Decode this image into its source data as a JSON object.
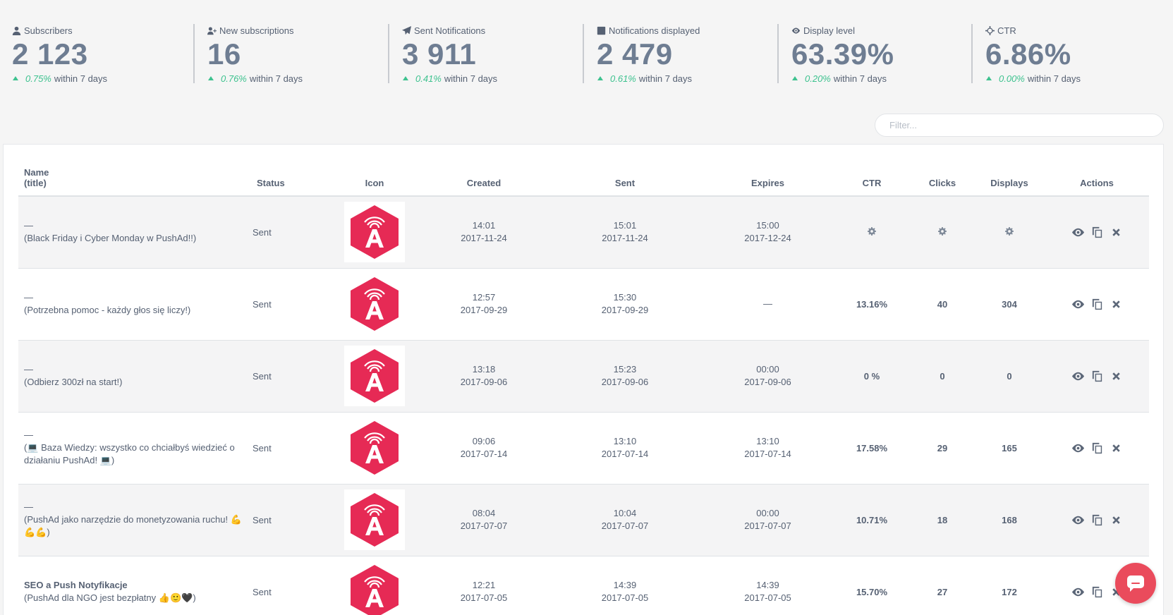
{
  "stats": [
    {
      "label": "Subscribers",
      "icon": "user-icon",
      "value": "2 123",
      "pct": "0.75%",
      "suffix": "within 7 days"
    },
    {
      "label": "New subscriptions",
      "icon": "user-plus-icon",
      "value": "16",
      "pct": "0.76%",
      "suffix": "within 7 days"
    },
    {
      "label": "Sent Notifications",
      "icon": "paper-plane-icon",
      "value": "3 911",
      "pct": "0.41%",
      "suffix": "within 7 days"
    },
    {
      "label": "Notifications displayed",
      "icon": "check-square-icon",
      "value": "2 479",
      "pct": "0.61%",
      "suffix": "within 7 days"
    },
    {
      "label": "Display level",
      "icon": "eye-icon",
      "value": "63.39%",
      "pct": "0.20%",
      "suffix": "within 7 days"
    },
    {
      "label": "CTR",
      "icon": "crosshair-icon",
      "value": "6.86%",
      "pct": "0.00%",
      "suffix": "within 7 days"
    }
  ],
  "filter": {
    "placeholder": "Filter..."
  },
  "table": {
    "headers": {
      "name": "Name",
      "title": "(title)",
      "status": "Status",
      "icon": "Icon",
      "created": "Created",
      "sent": "Sent",
      "expires": "Expires",
      "ctr": "CTR",
      "clicks": "Clicks",
      "displays": "Displays",
      "actions": "Actions"
    },
    "rows": [
      {
        "name": "—",
        "title": "(Black Friday i Cyber Monday w PushAd!!)",
        "status": "Sent",
        "created_time": "14:01",
        "created_date": "2017-11-24",
        "sent_time": "15:01",
        "sent_date": "2017-11-24",
        "expires_time": "15:00",
        "expires_date": "2017-12-24",
        "ctr": "",
        "clicks": "",
        "displays": "",
        "pending": true
      },
      {
        "name": "—",
        "title": "(Potrzebna pomoc - każdy głos się liczy!)",
        "status": "Sent",
        "created_time": "12:57",
        "created_date": "2017-09-29",
        "sent_time": "15:30",
        "sent_date": "2017-09-29",
        "expires_time": "—",
        "expires_date": "",
        "ctr": "13.16%",
        "clicks": "40",
        "displays": "304"
      },
      {
        "name": "—",
        "title": "(Odbierz 300zł na start!)",
        "status": "Sent",
        "created_time": "13:18",
        "created_date": "2017-09-06",
        "sent_time": "15:23",
        "sent_date": "2017-09-06",
        "expires_time": "00:00",
        "expires_date": "2017-09-06",
        "ctr": "0 %",
        "clicks": "0",
        "displays": "0"
      },
      {
        "name": "—",
        "title": "(💻 Baza Wiedzy: wszystko co chciałbyś wiedzieć o działaniu PushAd! 💻)",
        "status": "Sent",
        "created_time": "09:06",
        "created_date": "2017-07-14",
        "sent_time": "13:10",
        "sent_date": "2017-07-14",
        "expires_time": "13:10",
        "expires_date": "2017-07-14",
        "ctr": "17.58%",
        "clicks": "29",
        "displays": "165"
      },
      {
        "name": "—",
        "title": "(PushAd jako narzędzie do monetyzowania ruchu! 💪💪💪)",
        "status": "Sent",
        "created_time": "08:04",
        "created_date": "2017-07-07",
        "sent_time": "10:04",
        "sent_date": "2017-07-07",
        "expires_time": "00:00",
        "expires_date": "2017-07-07",
        "ctr": "10.71%",
        "clicks": "18",
        "displays": "168"
      },
      {
        "name": "SEO a Push Notyfikacje",
        "title": "(PushAd dla NGO jest bezpłatny 👍🙂🖤)",
        "status": "Sent",
        "created_time": "12:21",
        "created_date": "2017-07-05",
        "sent_time": "14:39",
        "sent_date": "2017-07-05",
        "expires_time": "14:39",
        "expires_date": "2017-07-05",
        "ctr": "15.70%",
        "clicks": "27",
        "displays": "172",
        "bold_name": true
      }
    ]
  },
  "colors": {
    "accent": "#e62a55",
    "positive": "#3ec28f",
    "chat": "#ea4b5c"
  }
}
